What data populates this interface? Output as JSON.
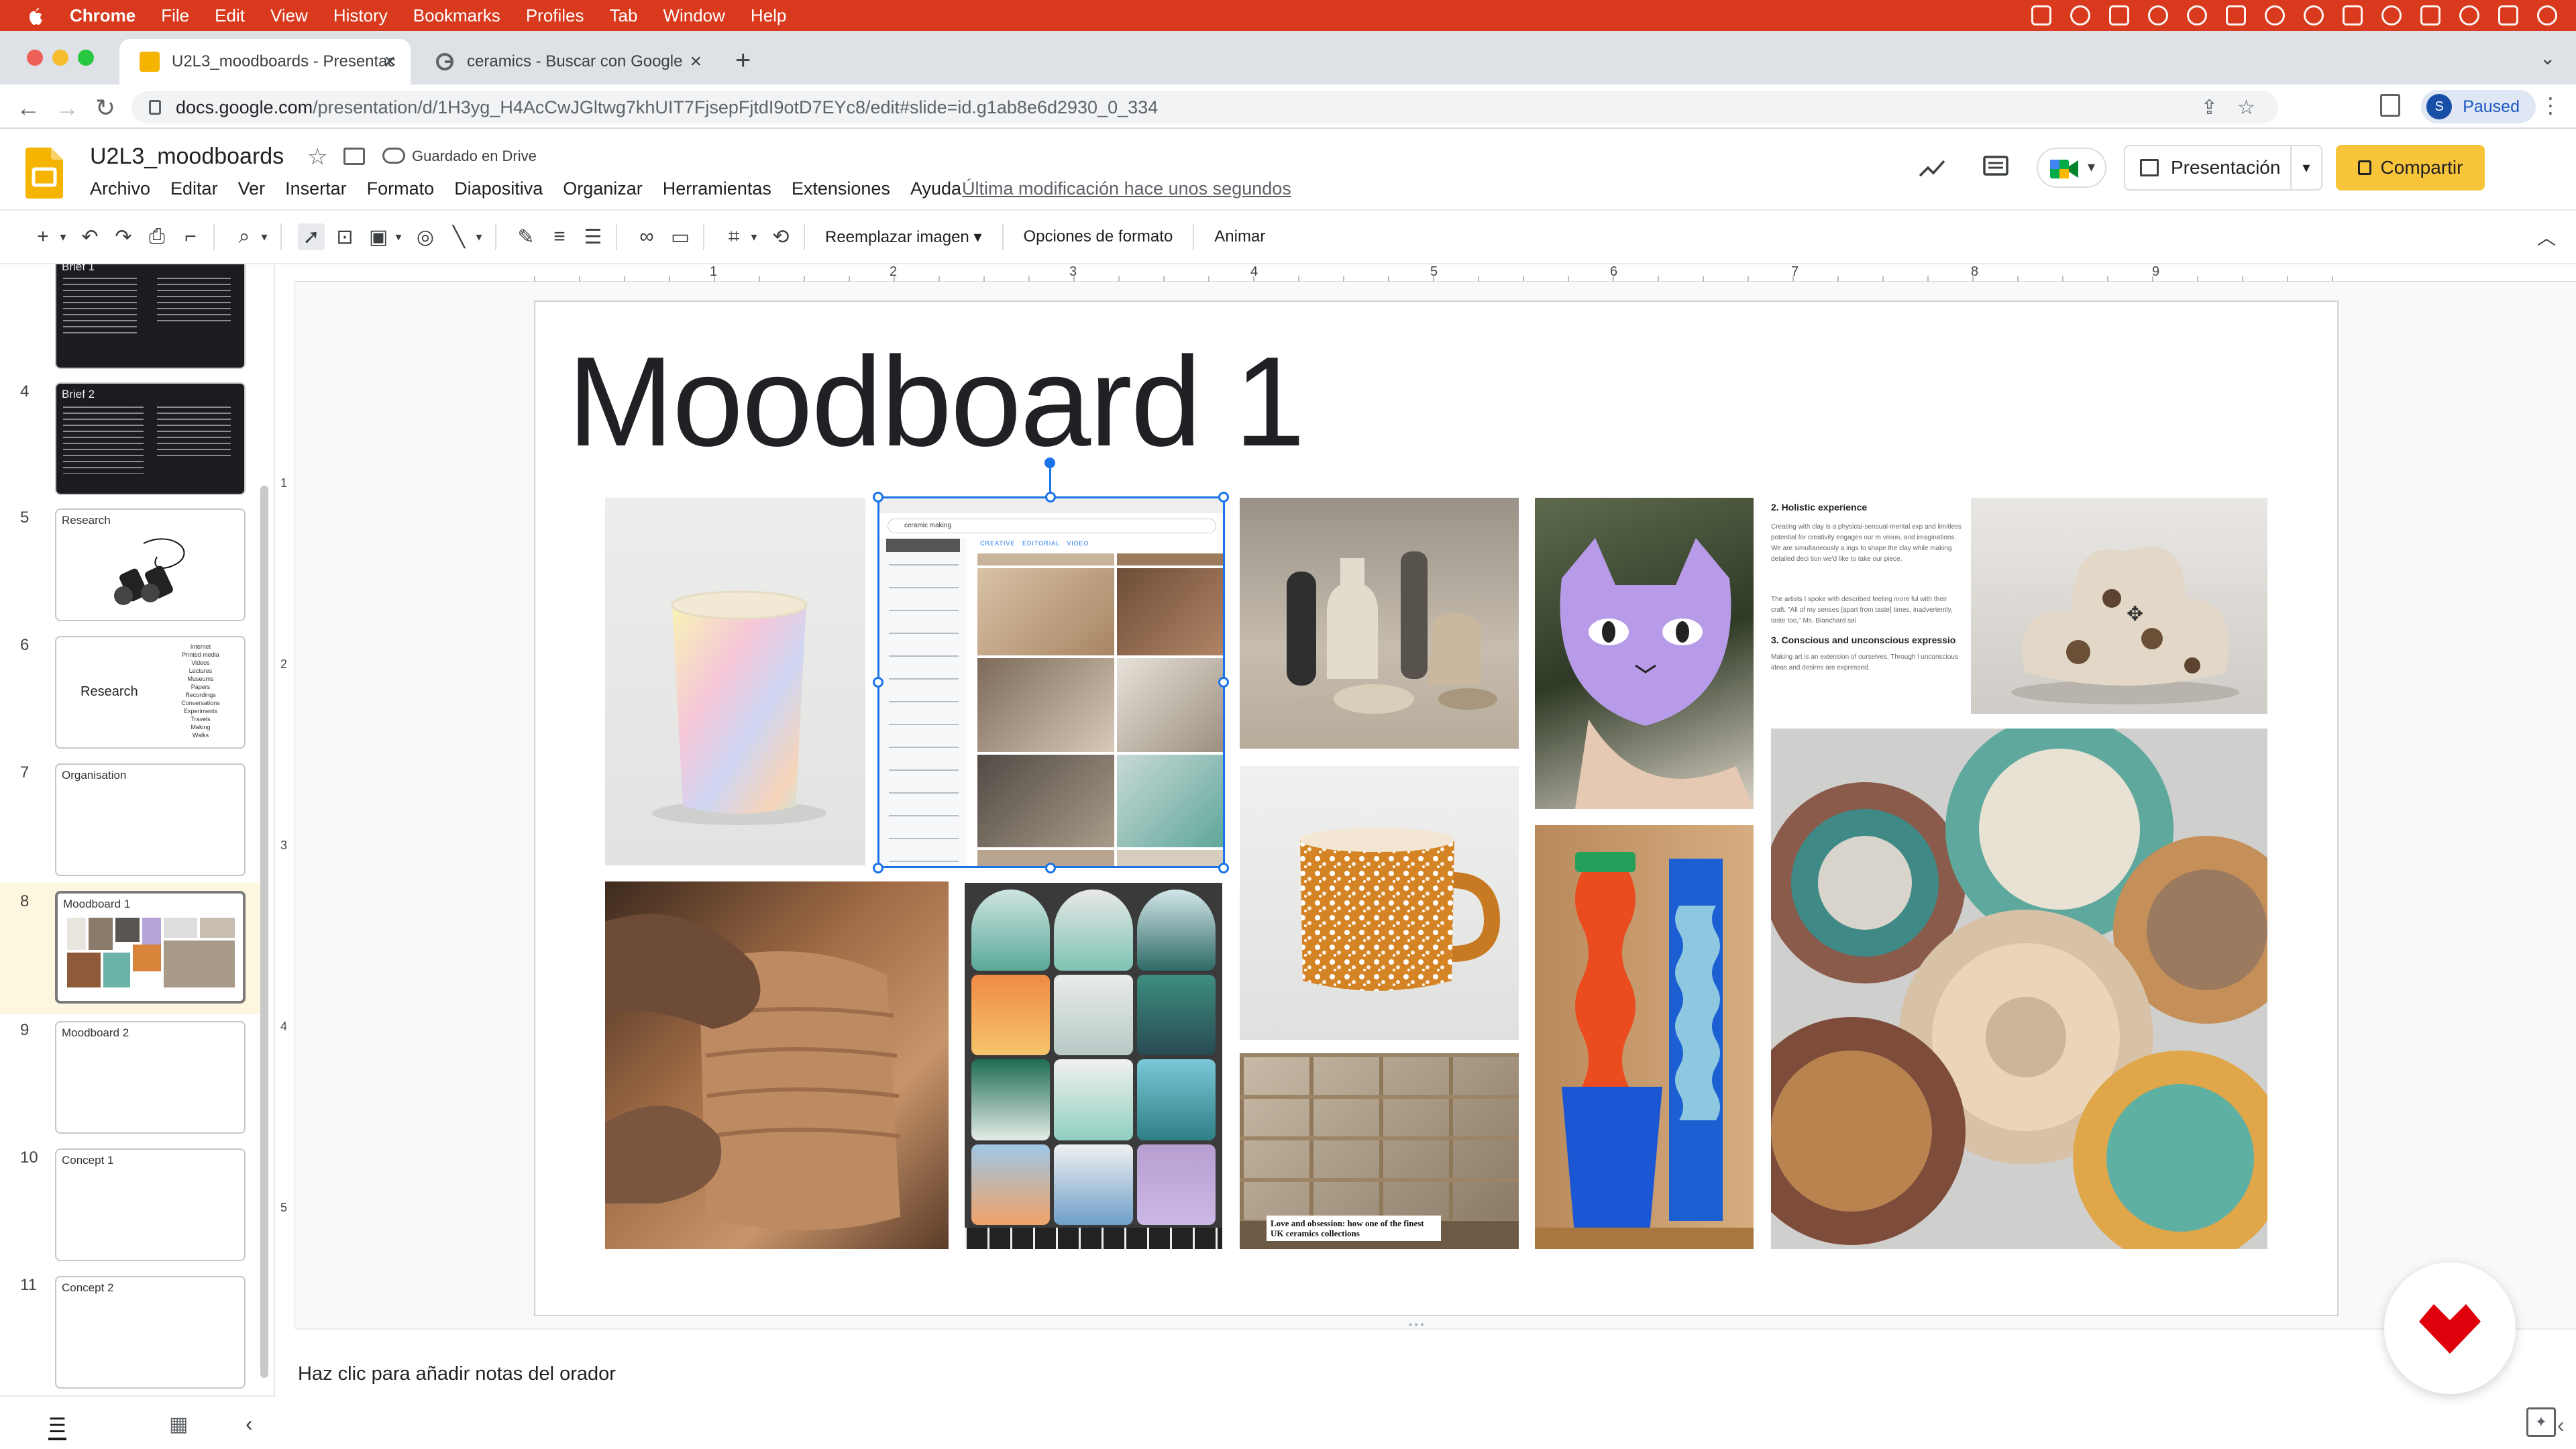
{
  "mac_menubar": {
    "app": "Chrome",
    "items": [
      "File",
      "Edit",
      "View",
      "History",
      "Bookmarks",
      "Profiles",
      "Tab",
      "Window",
      "Help"
    ]
  },
  "browser": {
    "tabs": [
      {
        "title": "U2L3_moodboards - Presentac",
        "active": true
      },
      {
        "title": "ceramics - Buscar con Google",
        "active": false
      }
    ],
    "url_host": "docs.google.com",
    "url_path": "/presentation/d/1H3yg_H4AcCwJGltwg7khUIT7FjsepFjtdI9otD7EYc8/edit#slide=id.g1ab8e6d2930_0_334",
    "profile_initial": "S",
    "profile_status": "Paused"
  },
  "docs": {
    "title": "U2L3_moodboards",
    "saved_status": "Guardado en Drive",
    "menus": [
      "Archivo",
      "Editar",
      "Ver",
      "Insertar",
      "Formato",
      "Diapositiva",
      "Organizar",
      "Herramientas",
      "Extensiones",
      "Ayuda"
    ],
    "last_modified": "Última modificación hace unos segundos",
    "present_label": "Presentación",
    "share_label": "Compartir"
  },
  "toolbar": {
    "replace_image": "Reemplazar imagen",
    "format_options": "Opciones de formato",
    "animate": "Animar"
  },
  "ruler": {
    "h_ticks": [
      "1",
      "2",
      "3",
      "4",
      "5",
      "6",
      "7",
      "8",
      "9"
    ],
    "v_ticks": [
      "1",
      "2",
      "3",
      "4",
      "5"
    ]
  },
  "filmstrip": {
    "slides": [
      {
        "num": "",
        "label": "Brief 1",
        "kind": "dark"
      },
      {
        "num": "4",
        "label": "Brief 2",
        "kind": "dark"
      },
      {
        "num": "5",
        "label": "Research",
        "kind": "binoculars"
      },
      {
        "num": "6",
        "label": "Research",
        "kind": "list",
        "list": [
          "Internet",
          "Printed media",
          "Videos",
          "Lectures",
          "Museums",
          "Papers",
          "Recordings",
          "Conversations",
          "Experiments",
          "Travels",
          "Making",
          "Walks"
        ]
      },
      {
        "num": "7",
        "label": "Organisation",
        "kind": "blank"
      },
      {
        "num": "8",
        "label": "Moodboard 1",
        "kind": "moodboard",
        "selected": true
      },
      {
        "num": "9",
        "label": "Moodboard 2",
        "kind": "blank"
      },
      {
        "num": "10",
        "label": "Concept 1",
        "kind": "blank"
      },
      {
        "num": "11",
        "label": "Concept 2",
        "kind": "blank"
      }
    ]
  },
  "slide": {
    "title": "Moodboard 1",
    "article": {
      "h1": "2. Holistic experience",
      "p1": "Creating with clay is a physical-sensual-mental exp and limitless potential for creativity engages our m vision, and imaginations. We are simultaneously a ings to shape the clay while making detailed deci tion we'd like to take our piece.",
      "p2": "The artists I spoke with described feeling more ful with their craft. \"All of my senses [apart from taste] times, inadvertently, taste too,\" Ms. Blanchard sai",
      "h2": "3. Conscious and unconscious expressio",
      "p3": "Making art is an extension of ourselves. Through l unconscious ideas and desires are expressed."
    },
    "book_caption": "Love and obsession: how one of the finest UK ceramics collections",
    "screenshot_tabs": [
      "CREATIVE",
      "EDITORIAL",
      "VIDEO"
    ],
    "screenshot_search": "ceramic making"
  },
  "notes_placeholder": "Haz clic para añadir notas del orador",
  "colors": {
    "menubar": "#d93a1e",
    "share": "#f7c43a",
    "selection": "#1a73e8"
  }
}
